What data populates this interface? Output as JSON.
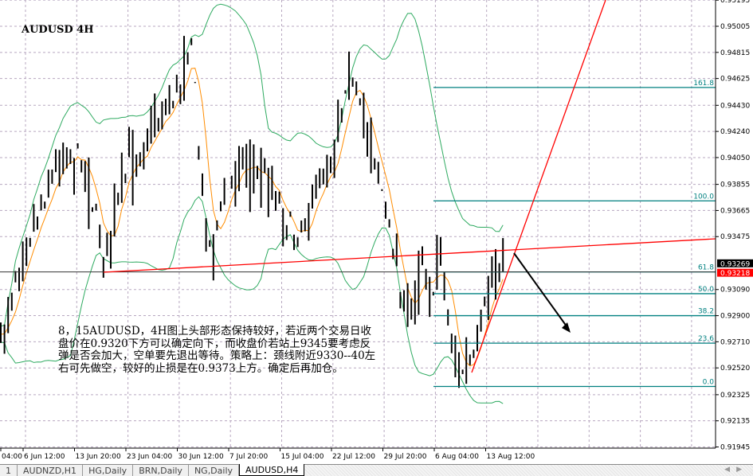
{
  "chart_title": "AUDUSD 4H",
  "note": "8，15AUDUSD，4H图上头部形态保持较好，若近两个交易日收盘价在0.9320下方可以确定向下，而收盘价若站上9345要考虑反弹是否会加大，空单要先退出等待。策略上：颈线附近9330--40左右可先做空，较好的止损是在0.9373上方。确定后再加仓。",
  "price_axis": [
    "0.95195",
    "0.95005",
    "0.94815",
    "0.94625",
    "0.94430",
    "0.94240",
    "0.94050",
    "0.93855",
    "0.93665",
    "0.93475",
    "0.93090",
    "0.92900",
    "0.92710",
    "0.92520",
    "0.92325",
    "0.92135",
    "0.91945"
  ],
  "price_values": [
    0.95195,
    0.95005,
    0.94815,
    0.94625,
    0.9443,
    0.9424,
    0.9405,
    0.93855,
    0.93665,
    0.93475,
    0.9309,
    0.929,
    0.9271,
    0.9252,
    0.92325,
    0.92135,
    0.91945
  ],
  "ask_label": "0.93269",
  "bid_label": "0.93218",
  "ask_price": 0.93269,
  "bid_price": 0.93218,
  "time_axis": [
    "04:00",
    "6 Jun 12:00",
    "13 Jun 20:00",
    "23 Jun 04:00",
    "30 Jun 12:00",
    "7 Jul 20:00",
    "15 Jul 04:00",
    "22 Jul 12:00",
    "29 Jul 20:00",
    "6 Aug 04:00",
    "13 Aug 12:00"
  ],
  "fib_levels": [
    {
      "label": "161.8",
      "price": 0.9456
    },
    {
      "label": "100.0",
      "price": 0.93735
    },
    {
      "label": "61.8",
      "price": 0.93218
    },
    {
      "label": "50.0",
      "price": 0.9306
    },
    {
      "label": "38.2",
      "price": 0.929
    },
    {
      "label": "23.6",
      "price": 0.927
    },
    {
      "label": "0.0",
      "price": 0.92385
    }
  ],
  "tabs": [
    "1",
    "AUDNZD,H1",
    "HG,Daily",
    "BRN,Daily",
    "NG,Daily",
    "AUDUSD,H4"
  ],
  "active_tab": "AUDUSD,H4",
  "colors": {
    "fib": "#008080",
    "band": "#2eaa60",
    "ma": "#ff8c00",
    "trend": "#ff0000",
    "bid": "#ff0000",
    "ask": "#000000"
  }
}
